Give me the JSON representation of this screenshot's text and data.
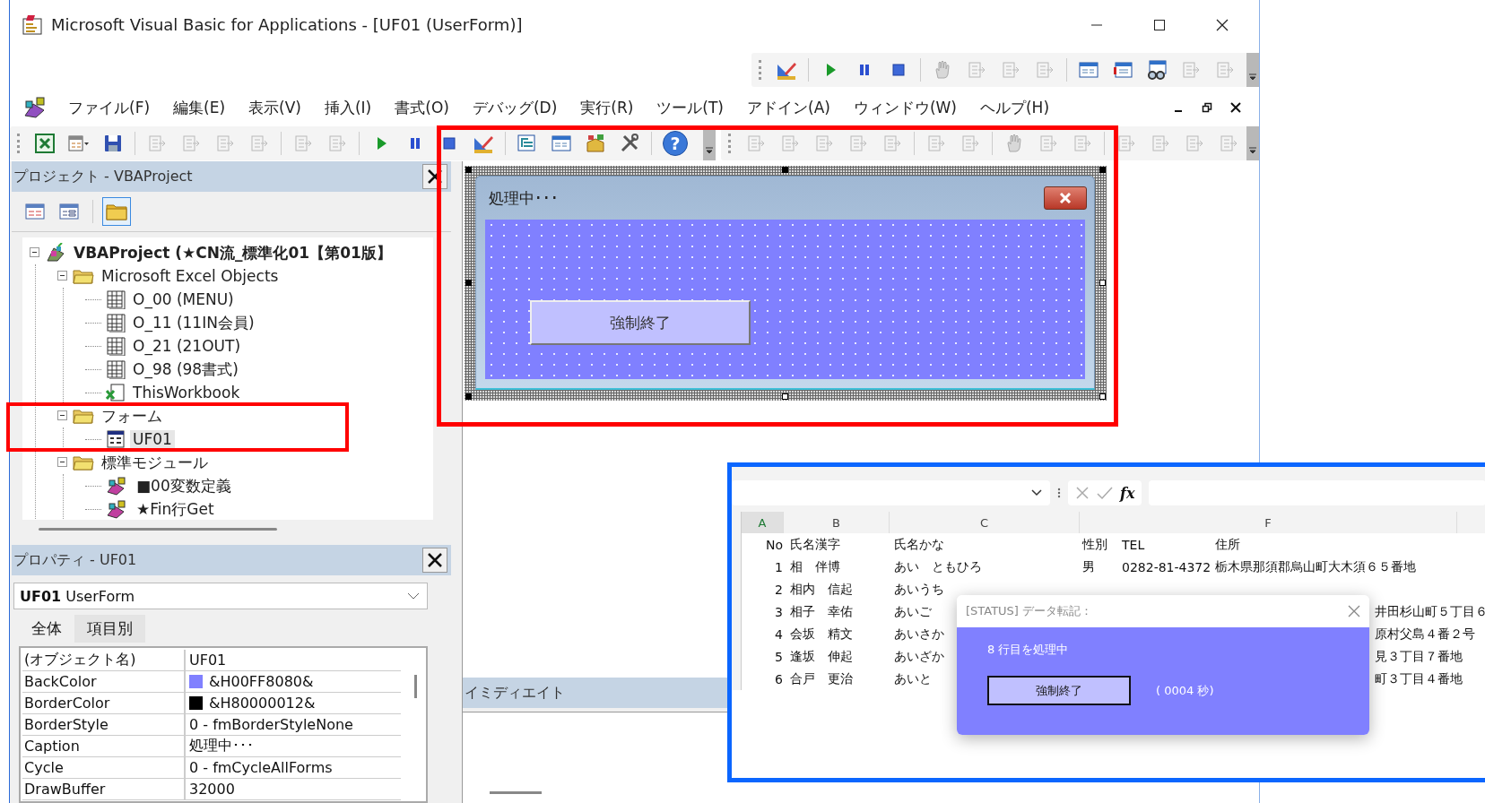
{
  "window": {
    "title": "Microsoft Visual Basic for Applications - [UF01 (UserForm)]"
  },
  "menu": [
    {
      "label": "ファイル(F)"
    },
    {
      "label": "編集(E)"
    },
    {
      "label": "表示(V)"
    },
    {
      "label": "挿入(I)"
    },
    {
      "label": "書式(O)"
    },
    {
      "label": "デバッグ(D)"
    },
    {
      "label": "実行(R)"
    },
    {
      "label": "ツール(T)"
    },
    {
      "label": "アドイン(A)"
    },
    {
      "label": "ウィンドウ(W)"
    },
    {
      "label": "ヘルプ(H)"
    }
  ],
  "toolbar": {
    "help_glyph": "?"
  },
  "project": {
    "title": "プロジェクト - VBAProject",
    "tree": [
      {
        "label": "VBAProject (★CN流_標準化01【第01版】",
        "kind": "project",
        "expanded": true,
        "selected": false,
        "children": [
          {
            "label": "Microsoft Excel Objects",
            "kind": "folder",
            "expanded": true,
            "selected": false,
            "children": [
              {
                "label": "O_00 (MENU)",
                "kind": "sheet",
                "selected": false
              },
              {
                "label": "O_11 (11IN会員)",
                "kind": "sheet",
                "selected": false
              },
              {
                "label": "O_21 (21OUT)",
                "kind": "sheet",
                "selected": false
              },
              {
                "label": "O_98 (98書式)",
                "kind": "sheet",
                "selected": false
              },
              {
                "label": "ThisWorkbook",
                "kind": "workbook",
                "selected": false
              }
            ]
          },
          {
            "label": "フォーム",
            "kind": "folder",
            "expanded": true,
            "selected": false,
            "children": [
              {
                "label": "UF01",
                "kind": "form",
                "selected": true
              }
            ]
          },
          {
            "label": "標準モジュール",
            "kind": "folder",
            "expanded": true,
            "selected": false,
            "children": [
              {
                "label": "■00変数定義",
                "kind": "module",
                "selected": false
              },
              {
                "label": "★Fin行Get",
                "kind": "module",
                "selected": false
              }
            ]
          }
        ]
      }
    ]
  },
  "properties": {
    "title": "プロパティ - UF01",
    "object": "**UF01** UserForm",
    "tabs": [
      {
        "label": "全体",
        "selected": true
      },
      {
        "label": "項目別",
        "selected": false
      }
    ],
    "rows": [
      {
        "name": "(オブジェクト名)",
        "value": "UF01"
      },
      {
        "name": "BackColor",
        "value": "&H00FF8080&",
        "color": "#8080ff"
      },
      {
        "name": "BorderColor",
        "value": "&H80000012&",
        "color": "#000000"
      },
      {
        "name": "BorderStyle",
        "value": "0 - fmBorderStyleNone"
      },
      {
        "name": "Caption",
        "value": "処理中･･･"
      },
      {
        "name": "Cycle",
        "value": "0 - fmCycleAllForms"
      },
      {
        "name": "DrawBuffer",
        "value": "32000"
      }
    ]
  },
  "designer": {
    "form_caption": "処理中･･･",
    "button": "強制終了"
  },
  "immediate": {
    "title": "イミディエイト"
  },
  "excel": {
    "fx": "fx",
    "columns": [
      "A",
      "B",
      "C",
      "F"
    ],
    "rows": [
      {
        "kind": "full",
        "no": "No",
        "name": "氏名漢字",
        "kana": "氏名かな",
        "gender": "性別",
        "tel": "TEL",
        "address": "住所"
      },
      {
        "kind": "full",
        "no": "1",
        "name": "相　伴博",
        "kana": "あい　ともひろ",
        "gender": "男",
        "tel": "0282-81-4372",
        "address": "栃木県那須郡烏山町大木須６５番地"
      },
      {
        "kind": "covered",
        "no": "2",
        "name": "相内　信起",
        "kana": "あいうち"
      },
      {
        "kind": "covered",
        "no": "3",
        "name": "相子　幸佑",
        "kana": "あいご",
        "address": "井田杉山町５丁目６"
      },
      {
        "kind": "covered",
        "no": "4",
        "name": "会坂　精文",
        "kana": "あいさか",
        "address": "原村父島４番２号"
      },
      {
        "kind": "covered",
        "no": "5",
        "name": "逢坂　伸起",
        "kana": "あいざか",
        "address": "見３丁目７番地"
      },
      {
        "kind": "covered",
        "no": "6",
        "name": "合戸　更治",
        "kana": "あいと",
        "address": "町３丁目４番地"
      }
    ],
    "dialog": {
      "title": "[STATUS] データ転記：",
      "message": "8 行目を処理中",
      "button": "強制終了",
      "elapsed": "( 0004 秒)"
    }
  }
}
